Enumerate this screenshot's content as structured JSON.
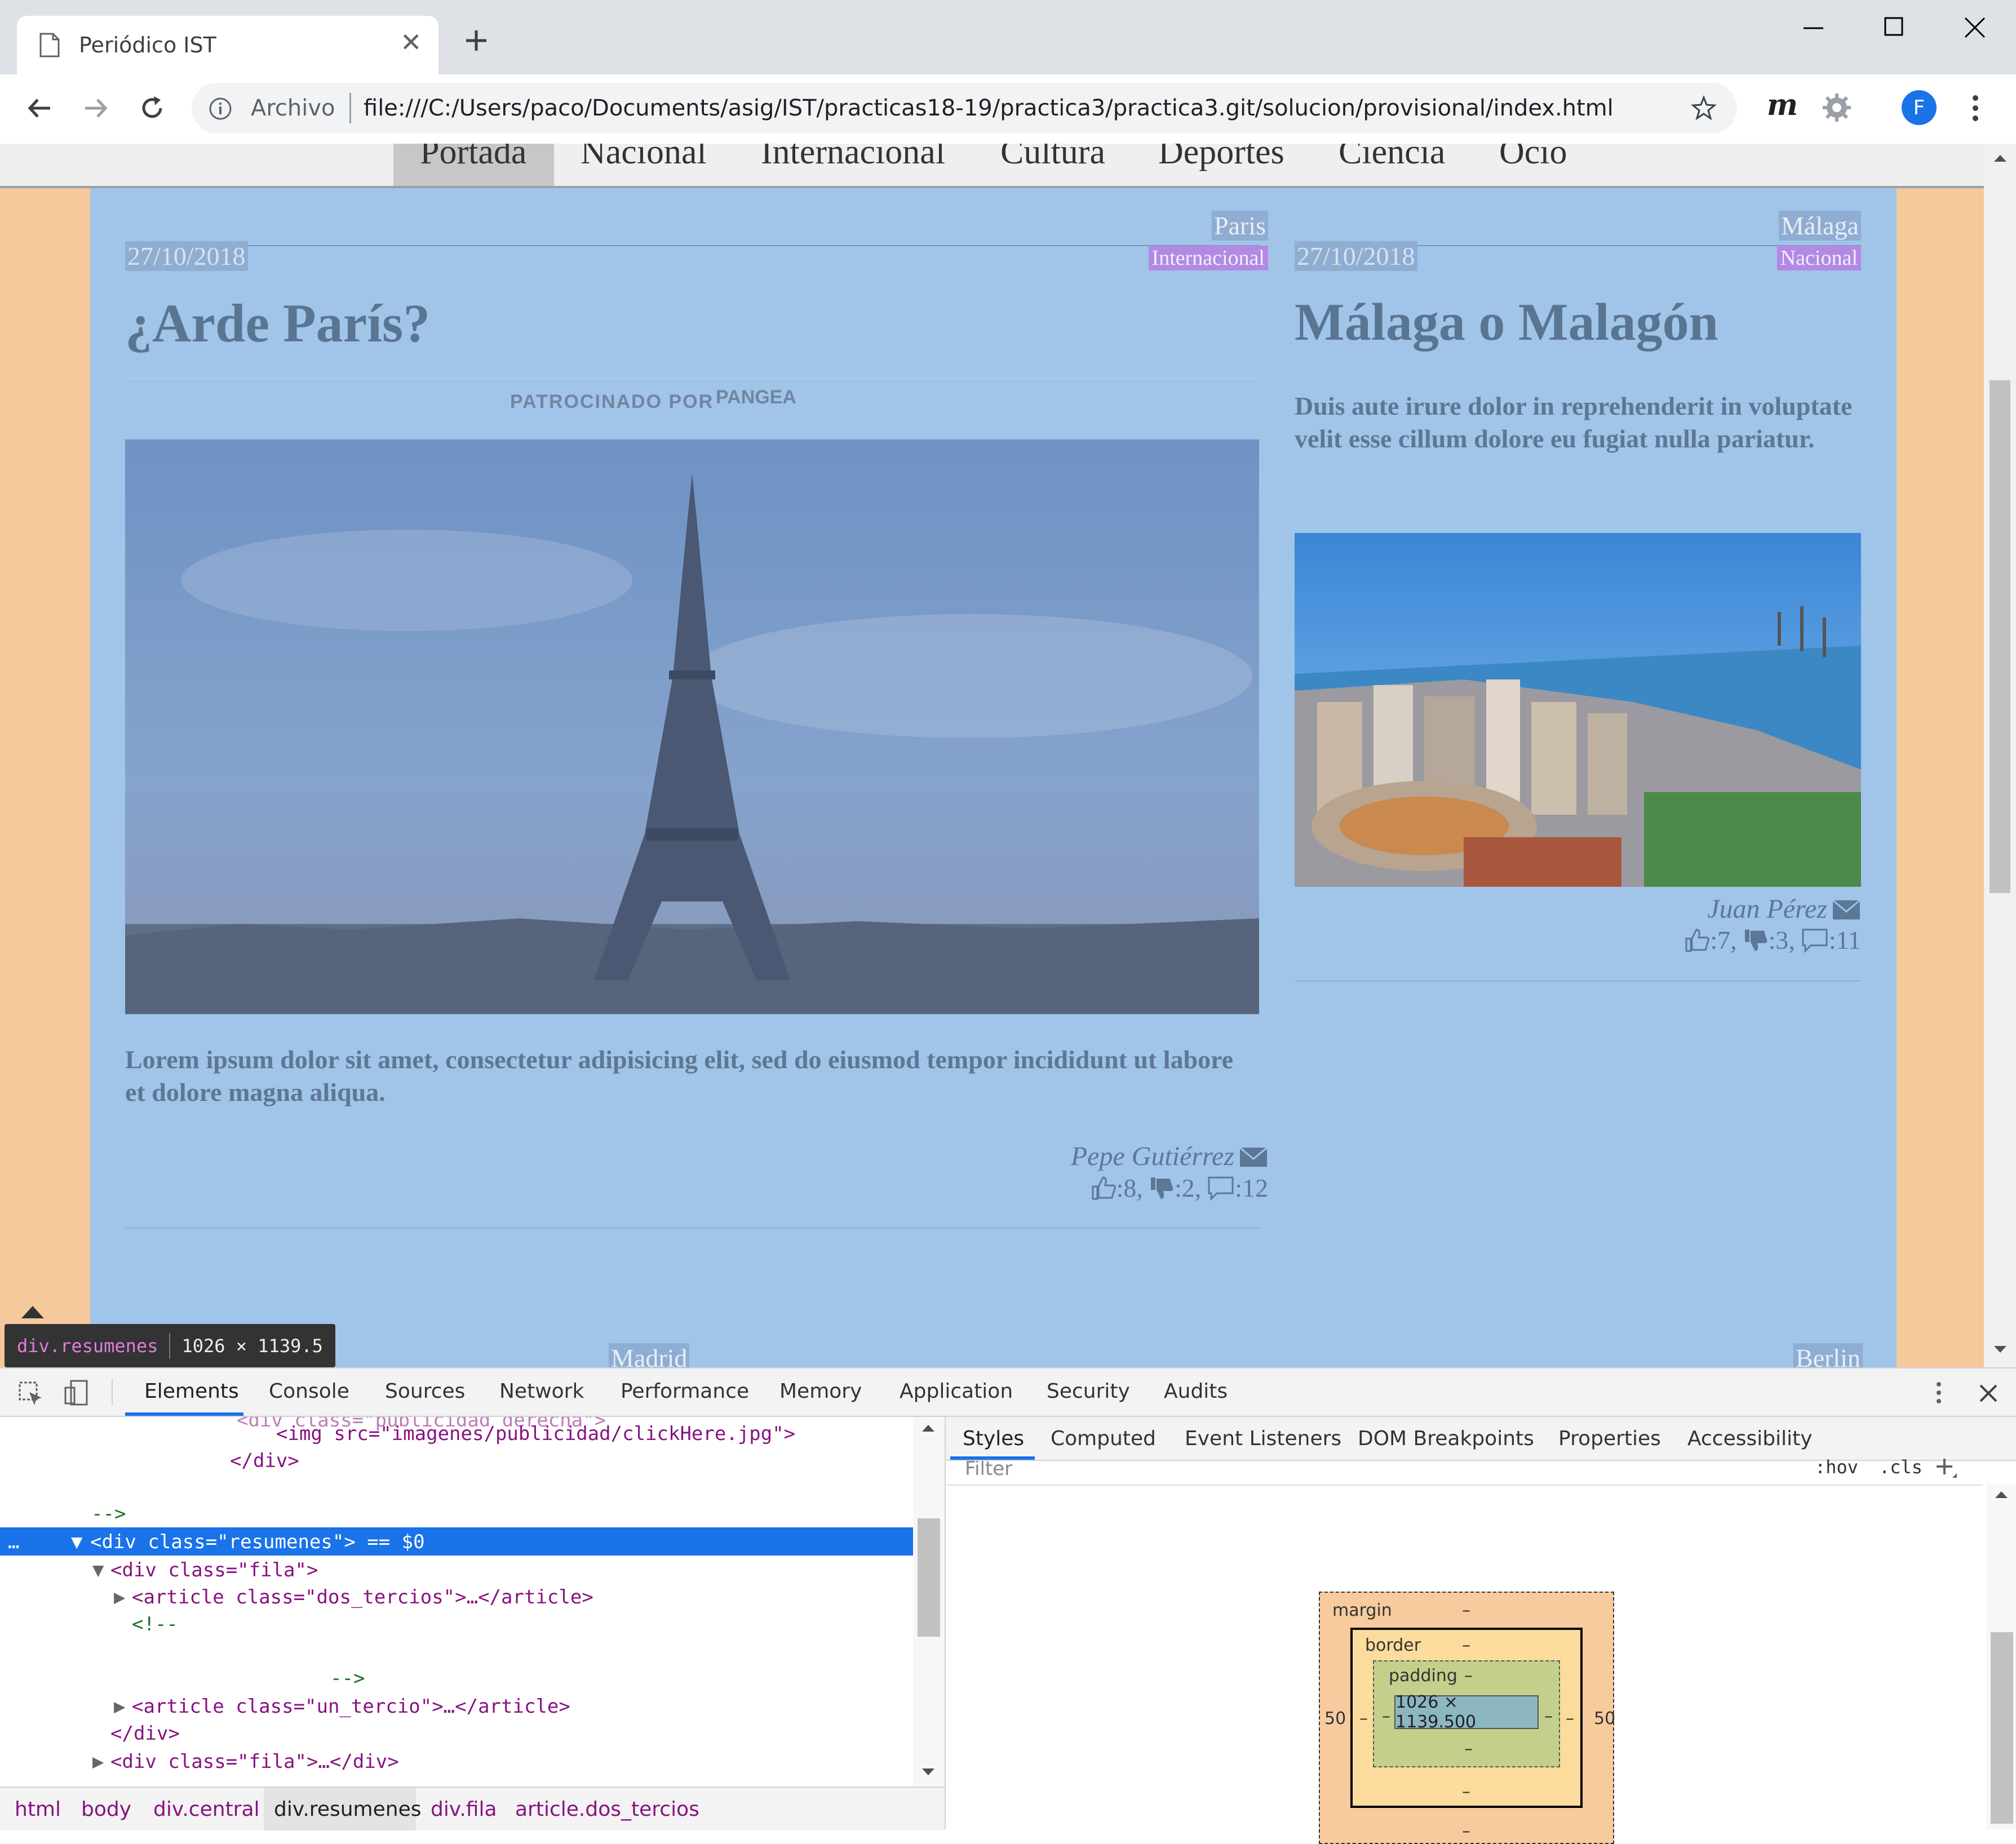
{
  "browser": {
    "tab_title": "Periódico IST",
    "new_tab_icon": "plus-icon",
    "address_prefix": "Archivo",
    "url": "file:///C:/Users/paco/Documents/asig/IST/practicas18-19/practica3/practica3.git/solucion/provisional/index.html",
    "profile_initial": "F",
    "extension_label": "m"
  },
  "nav": [
    "Portada",
    "Nacional",
    "Internacional",
    "Cultura",
    "Deportes",
    "Ciencia",
    "Ocio"
  ],
  "articles": [
    {
      "city": "Paris",
      "date": "27/10/2018",
      "section": "Internacional",
      "title": "¿Arde París?",
      "sponsor": "PATROCINADO POR",
      "sponsor_brand": "PANGEA",
      "lead": "Lorem ipsum dolor sit amet, consectetur adipisicing elit, sed do eiusmod tempor incididunt ut labore et dolore magna aliqua.",
      "author": "Pepe Gutiérrez",
      "likes": ":8,",
      "dislikes": ":2,",
      "comments": ":12"
    },
    {
      "city": "Málaga",
      "date": "27/10/2018",
      "section": "Nacional",
      "title": "Málaga o Malagón",
      "lead": "Duis aute irure dolor in reprehenderit in voluptate velit esse cillum dolore eu fugiat nulla pariatur.",
      "author": "Juan Pérez",
      "likes": ":7,",
      "dislikes": ":3,",
      "comments": ":11"
    }
  ],
  "next_cities": [
    "Madrid",
    "Berlin"
  ],
  "tooltip": {
    "selector": "div.resumenes",
    "size": "1026 × 1139.5"
  },
  "devtools": {
    "tabs": [
      "Elements",
      "Console",
      "Sources",
      "Network",
      "Performance",
      "Memory",
      "Application",
      "Security",
      "Audits"
    ],
    "code_lines": [
      "<img src=\"imagenes/publicidad/clickHere.jpg\">",
      "</div>",
      "-->",
      "<div class=\"resumenes\"> == $0",
      "<div class=\"fila\">",
      "<article class=\"dos_tercios\">…</article>",
      "<!--",
      "-->",
      "<article class=\"un_tercio\">…</article>",
      "</div>",
      "<div class=\"fila\">…</div>"
    ],
    "side_tabs": [
      "Styles",
      "Computed",
      "Event Listeners",
      "DOM Breakpoints",
      "Properties",
      "Accessibility"
    ],
    "filter_placeholder": "Filter",
    "hov": ":hov",
    "cls": ".cls",
    "box_model": {
      "margin_label": "margin",
      "border_label": "border",
      "padding_label": "padding",
      "margin_left": "50",
      "margin_right": "50",
      "dash": "–",
      "content_size": "1026 × 1139.500"
    },
    "breadcrumbs": [
      "html",
      "body",
      "div.central",
      "div.resumenes",
      "div.fila",
      "article.dos_tercios"
    ]
  },
  "colors": {
    "page_bg": "#f5c99c",
    "content_highlight": "#a1c4e9",
    "section_badge": "#b389e3",
    "selected_row": "#1a73e8"
  }
}
